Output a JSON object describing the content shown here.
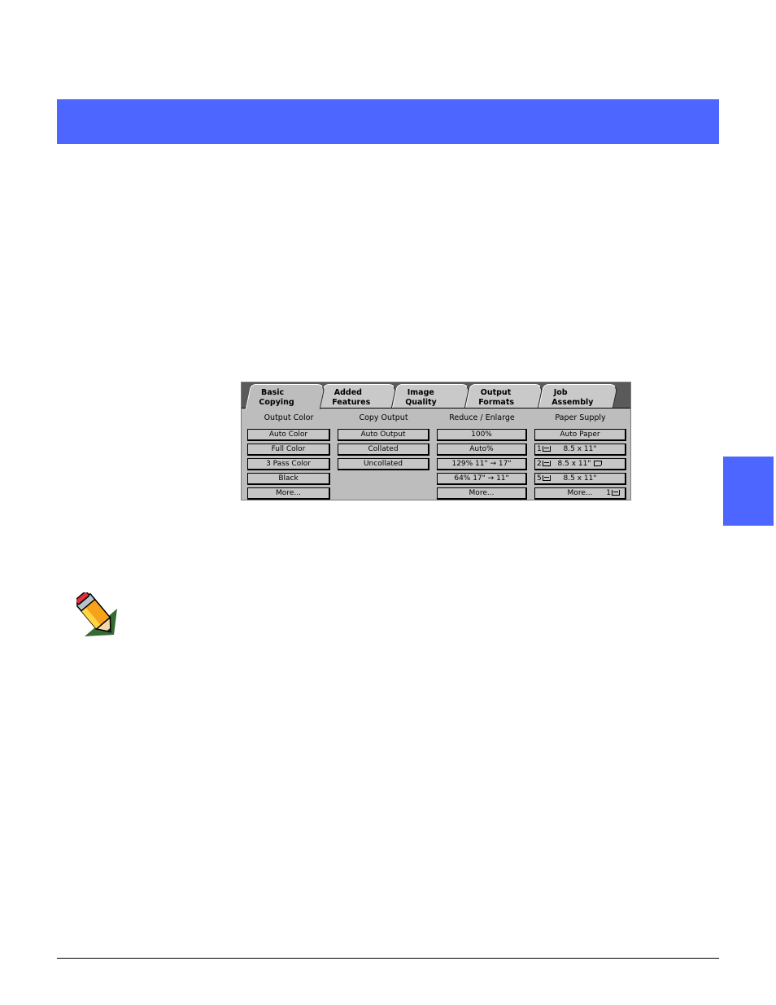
{
  "page": {
    "accent_color": "#4d66ff"
  },
  "copier_ui": {
    "tabs": [
      {
        "line1": "Basic",
        "line2": "Copying",
        "active": true
      },
      {
        "line1": "Added",
        "line2": "Features",
        "active": false
      },
      {
        "line1": "Image",
        "line2": "Quality",
        "active": false
      },
      {
        "line1": "Output",
        "line2": "Formats",
        "active": false
      },
      {
        "line1": "Job",
        "line2": "Assembly",
        "active": false
      }
    ],
    "columns": [
      {
        "title": "Output Color",
        "buttons": [
          "Auto Color",
          "Full Color",
          "3 Pass Color",
          "Black",
          "More..."
        ]
      },
      {
        "title": "Copy Output",
        "buttons": [
          "Auto Output",
          "Collated",
          "Uncollated"
        ]
      },
      {
        "title": "Reduce / Enlarge",
        "buttons": [
          "100%",
          "Auto%",
          "129%  11\" → 17\"",
          "64%  17\" → 11\"",
          "More..."
        ]
      },
      {
        "title": "Paper Supply",
        "buttons": [
          {
            "tray": "",
            "label": "Auto Paper"
          },
          {
            "tray": "1",
            "label": "8.5 x 11\""
          },
          {
            "tray": "2",
            "label": "8.5 x 11\""
          },
          {
            "tray": "5",
            "label": "8.5 x 11\""
          },
          {
            "tray": "1",
            "label": "More..."
          }
        ]
      }
    ]
  },
  "note": {
    "icon": "pencil-icon"
  }
}
